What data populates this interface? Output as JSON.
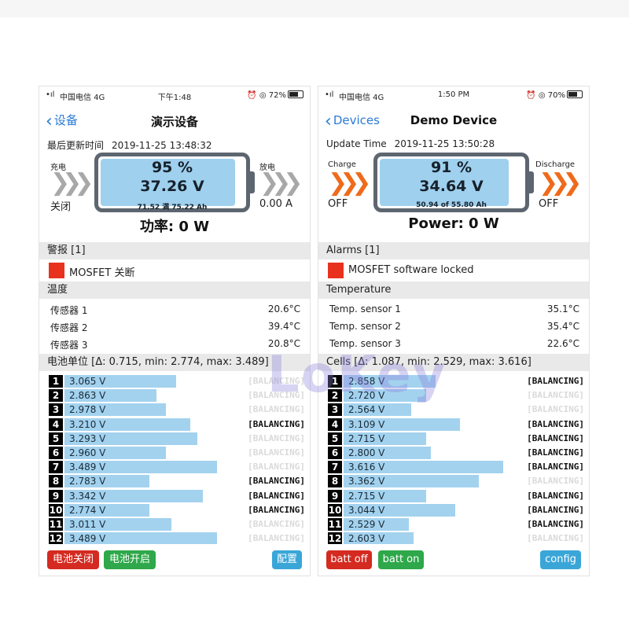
{
  "left": {
    "status": {
      "signal": "•ıl",
      "carrier": "中国电信 4G",
      "time": "下午1:48",
      "right": "⏰ ◎ 72%"
    },
    "nav": {
      "back": "设备",
      "title": "演示设备"
    },
    "update_label": "最后更新时间",
    "update_time": "2019-11-25 13:48:32",
    "charge_label": "充电",
    "charge_state": "关闭",
    "discharge_label": "放电",
    "discharge_state": "0.00 A",
    "battery": {
      "percent": "95 %",
      "voltage": "37.26 V",
      "capacity": "71.52 满 75.22 Ah",
      "level": 0.95
    },
    "power": "功率: 0 W",
    "alarms_header": "警报 [1]",
    "alarm_text": "MOSFET 关断",
    "temp_header": "温度",
    "temps": [
      {
        "name": "传感器 1",
        "value": "20.6°C"
      },
      {
        "name": "传感器 2",
        "value": "39.4°C"
      },
      {
        "name": "传感器 3",
        "value": "20.8°C"
      }
    ],
    "cells_header": "电池单位 [Δ: 0.715, min: 2.774, max: 3.489]",
    "cells": [
      {
        "n": "1",
        "v": "3.065 V",
        "level": 0.46,
        "bal": "[BALANCING]",
        "on": false
      },
      {
        "n": "2",
        "v": "2.863 V",
        "level": 0.38,
        "bal": "[BALANCING]",
        "on": false
      },
      {
        "n": "3",
        "v": "2.978 V",
        "level": 0.42,
        "bal": "[BALANCING]",
        "on": false
      },
      {
        "n": "4",
        "v": "3.210 V",
        "level": 0.52,
        "bal": "[BALANCING]",
        "on": true
      },
      {
        "n": "5",
        "v": "3.293 V",
        "level": 0.55,
        "bal": "[BALANCING]",
        "on": false
      },
      {
        "n": "6",
        "v": "2.960 V",
        "level": 0.42,
        "bal": "[BALANCING]",
        "on": false
      },
      {
        "n": "7",
        "v": "3.489 V",
        "level": 0.63,
        "bal": "[BALANCING]",
        "on": false
      },
      {
        "n": "8",
        "v": "2.783 V",
        "level": 0.35,
        "bal": "[BALANCING]",
        "on": true
      },
      {
        "n": "9",
        "v": "3.342 V",
        "level": 0.57,
        "bal": "[BALANCING]",
        "on": true
      },
      {
        "n": "10",
        "v": "2.774 V",
        "level": 0.35,
        "bal": "[BALANCING]",
        "on": true
      },
      {
        "n": "11",
        "v": "3.011 V",
        "level": 0.44,
        "bal": "[BALANCING]",
        "on": false
      },
      {
        "n": "12",
        "v": "3.489 V",
        "level": 0.63,
        "bal": "[BALANCING]",
        "on": false
      }
    ],
    "buttons": {
      "off": "电池关闭",
      "on": "电池开启",
      "config": "配置"
    }
  },
  "right": {
    "status": {
      "signal": "•ıl",
      "carrier": "中国电信 4G",
      "time": "1:50 PM",
      "right": "⏰ ◎ 70%"
    },
    "nav": {
      "back": "Devices",
      "title": "Demo Device"
    },
    "update_label": "Update Time",
    "update_time": "2019-11-25 13:50:28",
    "charge_label": "Charge",
    "charge_state": "OFF",
    "discharge_label": "Discharge",
    "discharge_state": "OFF",
    "battery": {
      "percent": "91 %",
      "voltage": "34.64 V",
      "capacity": "50.94 of 55.80 Ah",
      "level": 0.91
    },
    "power": "Power: 0 W",
    "alarms_header": "Alarms [1]",
    "alarm_text": "MOSFET software locked",
    "temp_header": "Temperature",
    "temps": [
      {
        "name": "Temp. sensor 1",
        "value": "35.1°C"
      },
      {
        "name": "Temp. sensor 2",
        "value": "35.4°C"
      },
      {
        "name": "Temp. sensor 3",
        "value": "22.6°C"
      }
    ],
    "cells_header": "Cells [Δ: 1.087, min: 2.529, max: 3.616]",
    "cells": [
      {
        "n": "1",
        "v": "2.858 V",
        "level": 0.38,
        "bal": "[BALANCING]",
        "on": true
      },
      {
        "n": "2",
        "v": "2.720 V",
        "level": 0.34,
        "bal": "[BALANCING]",
        "on": false
      },
      {
        "n": "3",
        "v": "2.564 V",
        "level": 0.28,
        "bal": "[BALANCING]",
        "on": false
      },
      {
        "n": "4",
        "v": "3.109 V",
        "level": 0.48,
        "bal": "[BALANCING]",
        "on": true
      },
      {
        "n": "5",
        "v": "2.715 V",
        "level": 0.34,
        "bal": "[BALANCING]",
        "on": true
      },
      {
        "n": "6",
        "v": "2.800 V",
        "level": 0.36,
        "bal": "[BALANCING]",
        "on": true
      },
      {
        "n": "7",
        "v": "3.616 V",
        "level": 0.66,
        "bal": "[BALANCING]",
        "on": true
      },
      {
        "n": "8",
        "v": "3.362 V",
        "level": 0.56,
        "bal": "[BALANCING]",
        "on": false
      },
      {
        "n": "9",
        "v": "2.715 V",
        "level": 0.34,
        "bal": "[BALANCING]",
        "on": true
      },
      {
        "n": "10",
        "v": "3.044 V",
        "level": 0.46,
        "bal": "[BALANCING]",
        "on": true
      },
      {
        "n": "11",
        "v": "2.529 V",
        "level": 0.27,
        "bal": "[BALANCING]",
        "on": true
      },
      {
        "n": "12",
        "v": "2.603 V",
        "level": 0.29,
        "bal": "[BALANCING]",
        "on": false
      }
    ],
    "buttons": {
      "off": "batt off",
      "on": "batt on",
      "config": "config"
    }
  },
  "watermark": "LoKey"
}
